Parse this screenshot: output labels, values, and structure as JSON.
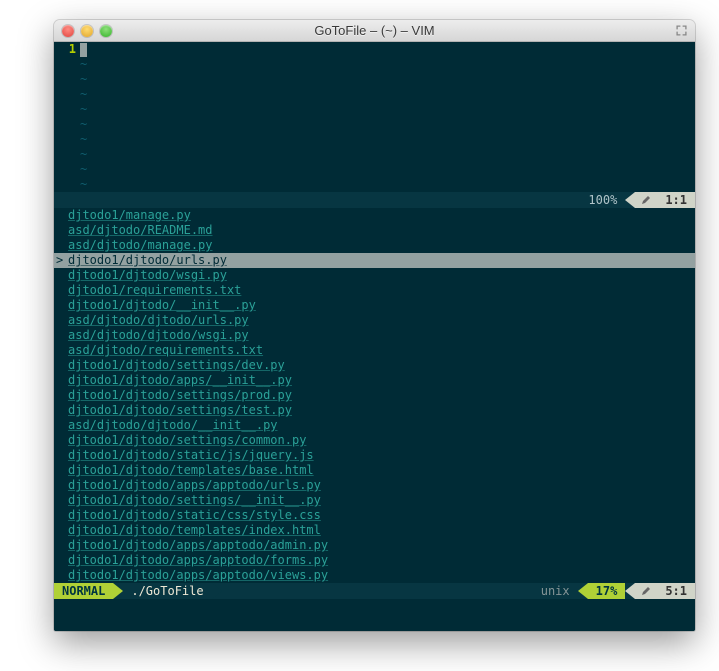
{
  "window": {
    "title": "GoToFile – (~) – VIM"
  },
  "editor": {
    "line_number": "1",
    "tilde_count": 9
  },
  "status_top": {
    "percent": "100%",
    "position": "1:1"
  },
  "filelist": {
    "selected_index": 3,
    "items": [
      "djtodo1/manage.py",
      "asd/djtodo/README.md",
      "asd/djtodo/manage.py",
      "djtodo1/djtodo/urls.py",
      "djtodo1/djtodo/wsgi.py",
      "djtodo1/requirements.txt",
      "djtodo1/djtodo/__init__.py",
      "asd/djtodo/djtodo/urls.py",
      "asd/djtodo/djtodo/wsgi.py",
      "asd/djtodo/requirements.txt",
      "djtodo1/djtodo/settings/dev.py",
      "djtodo1/djtodo/apps/__init__.py",
      "djtodo1/djtodo/settings/prod.py",
      "djtodo1/djtodo/settings/test.py",
      "asd/djtodo/djtodo/__init__.py",
      "djtodo1/djtodo/settings/common.py",
      "djtodo1/djtodo/static/js/jquery.js",
      "djtodo1/djtodo/templates/base.html",
      "djtodo1/djtodo/apps/apptodo/urls.py",
      "djtodo1/djtodo/settings/__init__.py",
      "djtodo1/djtodo/static/css/style.css",
      "djtodo1/djtodo/templates/index.html",
      "djtodo1/djtodo/apps/apptodo/admin.py",
      "djtodo1/djtodo/apps/apptodo/forms.py",
      "djtodo1/djtodo/apps/apptodo/views.py"
    ]
  },
  "status_bottom": {
    "mode": "NORMAL",
    "file": "./GoToFile",
    "fileformat": "unix",
    "percent": "17%",
    "position": "5:1"
  }
}
